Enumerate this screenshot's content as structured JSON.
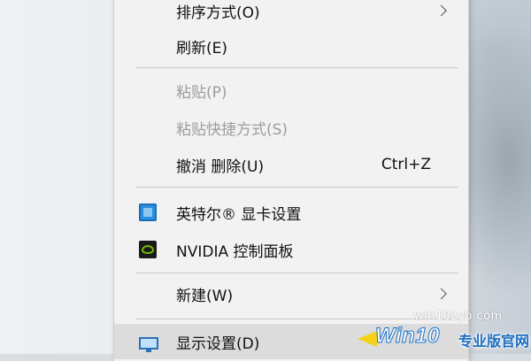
{
  "context_menu": {
    "items": [
      {
        "label": "排序方式(O)",
        "has_submenu": true
      },
      {
        "label": "刷新(E)"
      },
      {
        "label": "粘贴(P)",
        "disabled": true
      },
      {
        "label": "粘贴快捷方式(S)",
        "disabled": true
      },
      {
        "label": "撤消 删除(U)",
        "shortcut": "Ctrl+Z"
      },
      {
        "label": "英特尔® 显卡设置",
        "icon": "intel-graphics-icon"
      },
      {
        "label": "NVIDIA 控制面板",
        "icon": "nvidia-icon"
      },
      {
        "label": "新建(W)",
        "has_submenu": true
      },
      {
        "label": "显示设置(D)",
        "icon": "display-icon",
        "highlighted": true
      }
    ]
  },
  "watermark": {
    "url": "win10zyb.com",
    "brand": "Win10",
    "subtitle": "专业版官网"
  },
  "colors": {
    "menu_background": "#f2f2f2",
    "disabled_text": "#9d9d9d",
    "highlight": "#dcdcdc",
    "nvidia_green": "#76b900",
    "watermark_blue": "#1b6fc2",
    "watermark_yellow": "#f5d21a"
  }
}
